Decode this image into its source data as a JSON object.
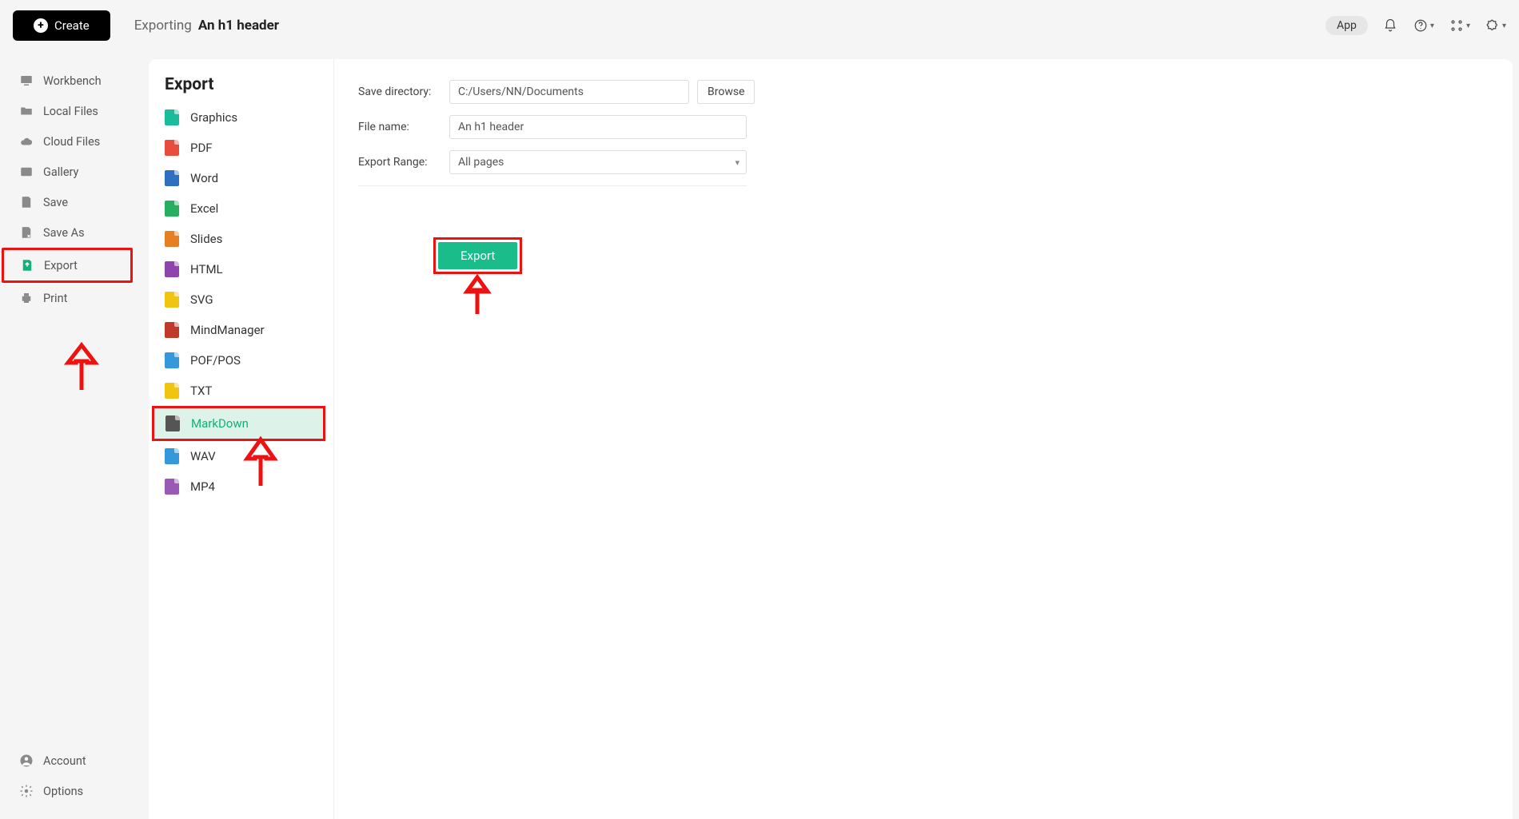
{
  "topbar": {
    "create_label": "Create",
    "breadcrumb_prefix": "Exporting",
    "doc_title": "An h1 header",
    "app_chip": "App"
  },
  "sidebar": {
    "items": [
      {
        "label": "Workbench",
        "icon": "workbench-icon"
      },
      {
        "label": "Local Files",
        "icon": "folder-icon"
      },
      {
        "label": "Cloud Files",
        "icon": "cloud-icon"
      },
      {
        "label": "Gallery",
        "icon": "gallery-icon"
      },
      {
        "label": "Save",
        "icon": "save-icon"
      },
      {
        "label": "Save As",
        "icon": "save-as-icon"
      },
      {
        "label": "Export",
        "icon": "export-icon",
        "highlighted": true,
        "selected": true
      },
      {
        "label": "Print",
        "icon": "print-icon"
      }
    ],
    "bottom": [
      {
        "label": "Account",
        "icon": "account-icon"
      },
      {
        "label": "Options",
        "icon": "gear-icon"
      }
    ]
  },
  "export_panel": {
    "title": "Export",
    "formats": [
      {
        "label": "Graphics",
        "color": "ico-teal"
      },
      {
        "label": "PDF",
        "color": "ico-red"
      },
      {
        "label": "Word",
        "color": "ico-blue"
      },
      {
        "label": "Excel",
        "color": "ico-green"
      },
      {
        "label": "Slides",
        "color": "ico-orange"
      },
      {
        "label": "HTML",
        "color": "ico-purple"
      },
      {
        "label": "SVG",
        "color": "ico-yellow"
      },
      {
        "label": "MindManager",
        "color": "ico-darkred"
      },
      {
        "label": "POF/POS",
        "color": "ico-cyan"
      },
      {
        "label": "TXT",
        "color": "ico-yellow"
      },
      {
        "label": "MarkDown",
        "color": "ico-gray",
        "selected": true,
        "highlighted": true
      },
      {
        "label": "WAV",
        "color": "ico-cyan"
      },
      {
        "label": "MP4",
        "color": "ico-violet"
      }
    ],
    "settings": {
      "save_dir_label": "Save directory:",
      "save_dir_value": "C:/Users/NN/Documents",
      "file_name_label": "File name:",
      "file_name_value": "An h1 header",
      "export_range_label": "Export Range:",
      "export_range_value": "All pages",
      "browse_label": "Browse",
      "export_button": "Export"
    }
  }
}
